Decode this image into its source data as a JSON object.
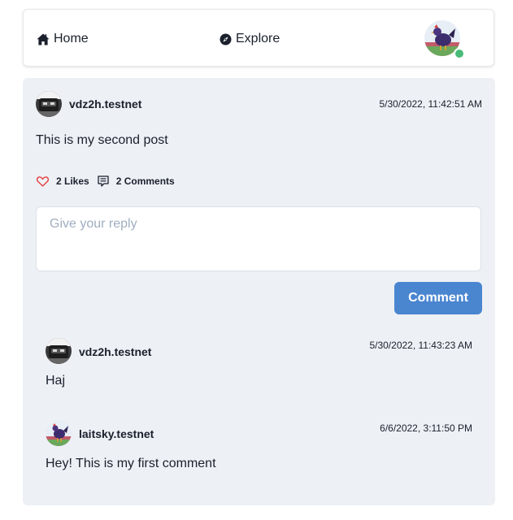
{
  "nav": {
    "home_label": "Home",
    "explore_label": "Explore",
    "online_status_color": "#48bb78"
  },
  "post": {
    "author": "vdz2h.testnet",
    "timestamp": "5/30/2022, 11:42:51 AM",
    "content": "This is my second post",
    "likes_label": "2 Likes",
    "comments_label": "2 Comments"
  },
  "reply": {
    "placeholder": "Give your reply",
    "value": "",
    "submit_label": "Comment"
  },
  "comments": [
    {
      "author": "vdz2h.testnet",
      "timestamp": "5/30/2022, 11:43:23 AM",
      "content": "Haj"
    },
    {
      "author": "laitsky.testnet",
      "timestamp": "6/6/2022, 3:11:50 PM",
      "content": "Hey! This is my first comment"
    }
  ],
  "colors": {
    "accent": "#4a85d0",
    "card_background": "#edf0f5",
    "like_heart": "#e53e3e"
  },
  "icons": {
    "home": "home-icon",
    "explore": "compass-icon",
    "like": "heart-icon",
    "comments": "comment-icon"
  }
}
